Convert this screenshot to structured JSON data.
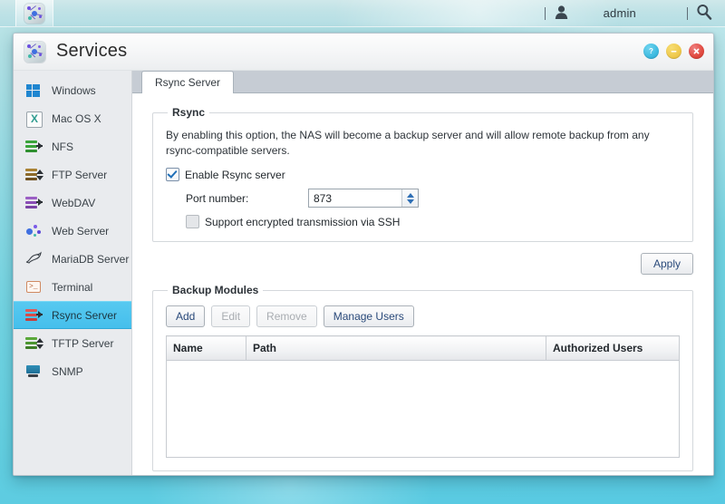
{
  "taskbar": {
    "app_icon": "services-icon",
    "user_icon": "user-icon",
    "username": "admin",
    "search_icon": "search-icon"
  },
  "window": {
    "title": "Services",
    "icon": "services-icon",
    "controls": {
      "help_label": "?",
      "minimize_label": "–",
      "close_label": "✕"
    }
  },
  "sidebar": {
    "items": [
      {
        "label": "Windows",
        "icon": "windows-icon",
        "selected": false
      },
      {
        "label": "Mac OS X",
        "icon": "apple-x-icon",
        "selected": false
      },
      {
        "label": "NFS",
        "icon": "nfs-icon",
        "selected": false
      },
      {
        "label": "FTP Server",
        "icon": "ftp-server-icon",
        "selected": false
      },
      {
        "label": "WebDAV",
        "icon": "webdav-icon",
        "selected": false
      },
      {
        "label": "Web Server",
        "icon": "web-server-icon",
        "selected": false
      },
      {
        "label": "MariaDB Server",
        "icon": "mariadb-icon",
        "selected": false
      },
      {
        "label": "Terminal",
        "icon": "terminal-icon",
        "selected": false
      },
      {
        "label": "Rsync Server",
        "icon": "rsync-server-icon",
        "selected": true
      },
      {
        "label": "TFTP Server",
        "icon": "tftp-server-icon",
        "selected": false
      },
      {
        "label": "SNMP",
        "icon": "snmp-icon",
        "selected": false
      }
    ]
  },
  "main": {
    "tabs": [
      {
        "label": "Rsync Server",
        "active": true
      }
    ],
    "rsync_group": {
      "legend": "Rsync",
      "description": "By enabling this option, the NAS will become a backup server and will allow remote backup from any rsync-compatible servers.",
      "enable_checkbox": {
        "label": "Enable Rsync server",
        "checked": true
      },
      "port_label": "Port number:",
      "port_value": "873",
      "ssh_checkbox": {
        "label": "Support encrypted transmission via SSH",
        "checked": false
      }
    },
    "apply_label": "Apply",
    "backup_modules": {
      "legend": "Backup Modules",
      "buttons": [
        {
          "label": "Add",
          "enabled": true
        },
        {
          "label": "Edit",
          "enabled": false
        },
        {
          "label": "Remove",
          "enabled": false
        },
        {
          "label": "Manage Users",
          "enabled": true
        }
      ],
      "table": {
        "columns": [
          "Name",
          "Path",
          "Authorized Users"
        ],
        "rows": []
      }
    }
  },
  "colors": {
    "selected_item": "#45bfec",
    "desktop": "#72d4e2",
    "button_text": "#2a4a7a",
    "close_button": "#e0493f",
    "minimize_button": "#efc94c",
    "help_button": "#3fbbe0"
  }
}
